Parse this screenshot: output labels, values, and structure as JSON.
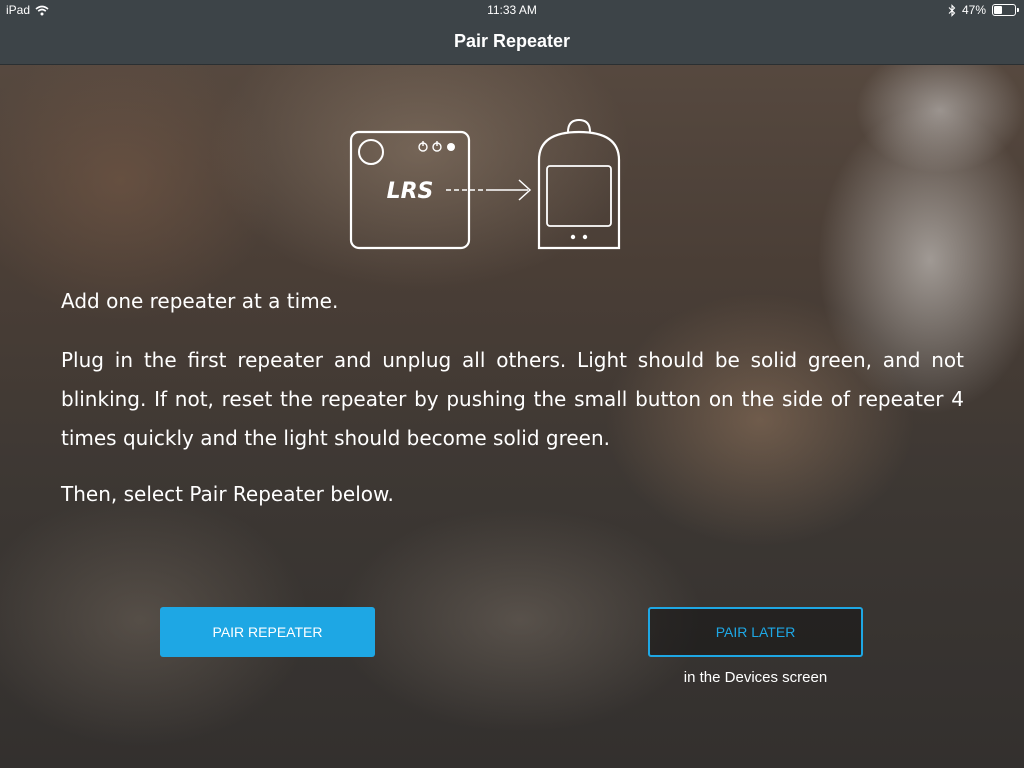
{
  "status_bar": {
    "device": "iPad",
    "time": "11:33 AM",
    "battery_percent": "47%",
    "battery_level": 0.47,
    "icons": [
      "wifi-icon",
      "bluetooth-icon",
      "battery-icon"
    ]
  },
  "nav": {
    "title": "Pair Repeater"
  },
  "illustration": {
    "device_label": "LRS"
  },
  "instructions": {
    "line1": "Add one repeater at a time.",
    "line2": "Plug in the first repeater and unplug all others. Light should be solid green, and not  blinking. If not, reset the repeater by pushing the small button on the side of repeater 4 times quickly and the light should become solid  green.",
    "line3": "Then, select Pair Repeater below."
  },
  "actions": {
    "pair_label": "PAIR REPEATER",
    "later_label": "PAIR LATER",
    "later_note": "in the Devices screen"
  },
  "colors": {
    "accent": "#1ea7e4",
    "bar": "#3d4448"
  }
}
